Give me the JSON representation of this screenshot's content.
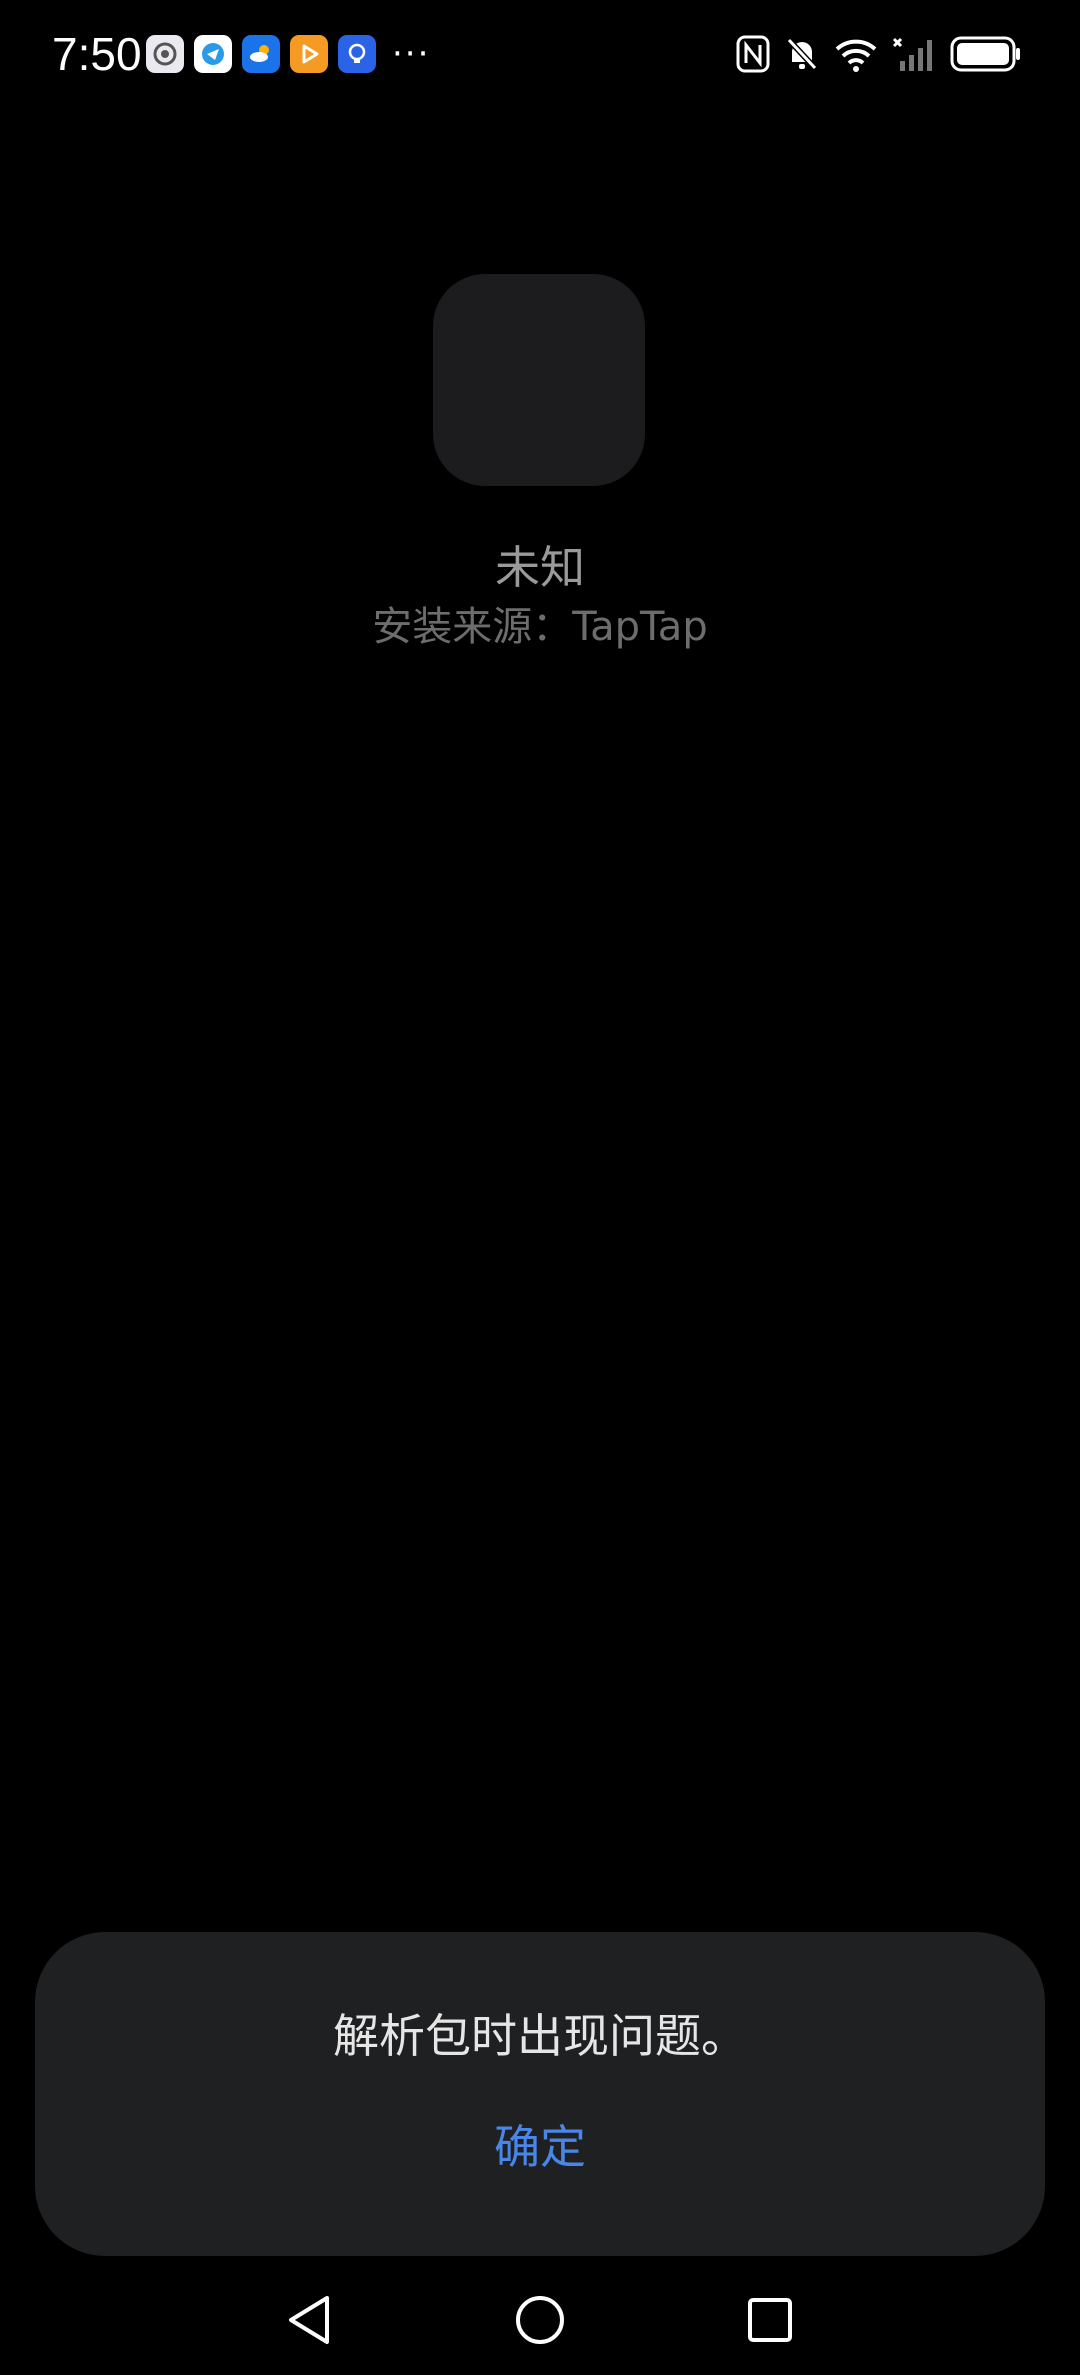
{
  "status_bar": {
    "time": "7:50",
    "notification_icons": [
      "settings-icon",
      "browser-icon",
      "weather-icon",
      "video-player-icon",
      "tips-bulb-icon"
    ],
    "more_indicator": "···",
    "system_icons": [
      "nfc-icon",
      "mute-bell-icon",
      "wifi-icon",
      "cellular-signal-icon",
      "battery-icon"
    ]
  },
  "app": {
    "name": "未知",
    "install_source": "安装来源：TapTap"
  },
  "dialog": {
    "message": "解析包时出现问题。",
    "confirm_label": "确定"
  },
  "nav_bar": {
    "buttons": [
      "back-icon",
      "home-icon",
      "recents-icon"
    ]
  },
  "colors": {
    "background": "#000000",
    "dialog_background": "#1f2022",
    "accent": "#4a86e8",
    "app_icon_placeholder": "#1c1c1e"
  }
}
